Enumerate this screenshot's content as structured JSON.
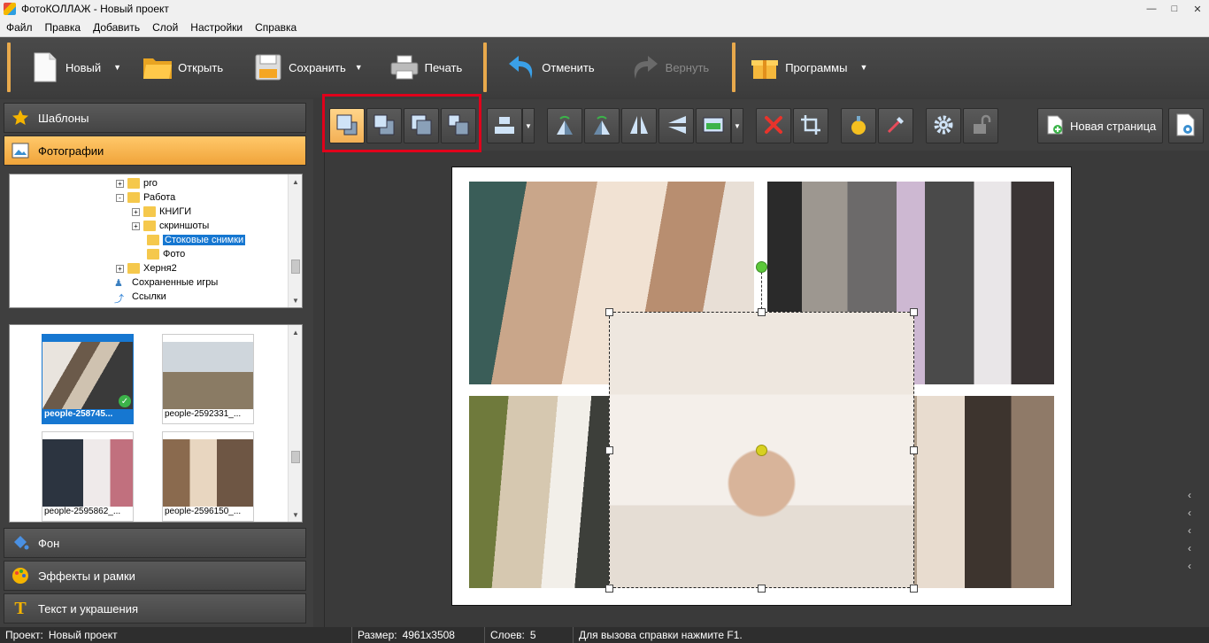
{
  "window": {
    "title": "ФотоКОЛЛАЖ - Новый проект",
    "controls": [
      "minimize-icon",
      "maximize-icon",
      "close-icon"
    ]
  },
  "menu": [
    "Файл",
    "Правка",
    "Добавить",
    "Слой",
    "Настройки",
    "Справка"
  ],
  "toolbar": {
    "new_label": "Новый",
    "open_label": "Открыть",
    "save_label": "Сохранить",
    "print_label": "Печать",
    "undo_label": "Отменить",
    "redo_label": "Вернуть",
    "programs_label": "Программы"
  },
  "left_panel": {
    "templates_label": "Шаблоны",
    "photos_label": "Фотографии",
    "background_label": "Фон",
    "effects_label": "Эффекты и рамки",
    "text_label": "Текст и украшения",
    "tree": [
      {
        "label": "pro",
        "expander": "+"
      },
      {
        "label": "Работа",
        "expander": "-"
      },
      {
        "label": "КНИГИ",
        "expander": "+"
      },
      {
        "label": "скриншоты",
        "expander": "+"
      },
      {
        "label": "Стоковые снимки",
        "selected": true
      },
      {
        "label": "Фото"
      },
      {
        "label": "Херня2",
        "expander": "+"
      },
      {
        "label": "Сохраненные игры"
      },
      {
        "label": "Ссылки"
      }
    ],
    "thumbnails": [
      {
        "caption": "people-258745...",
        "selected": true
      },
      {
        "caption": "people-2592331_..."
      },
      {
        "caption": "people-2595862_..."
      },
      {
        "caption": "people-2596150_..."
      }
    ]
  },
  "edit_toolbar": {
    "layer_buttons": [
      "bring-to-front-icon",
      "bring-forward-icon",
      "send-backward-icon",
      "send-to-back-icon"
    ],
    "new_page_label": "Новая страница"
  },
  "statusbar": {
    "project_label": "Проект:",
    "project_value": "Новый проект",
    "size_label": "Размер:",
    "size_value": "4961x3508",
    "layers_label": "Слоев:",
    "layers_value": "5",
    "help_text": "Для вызова справки нажмите F1."
  },
  "colors": {
    "accent": "#f0a43a",
    "highlight": "#e0001b",
    "selection": "#1677d1"
  }
}
